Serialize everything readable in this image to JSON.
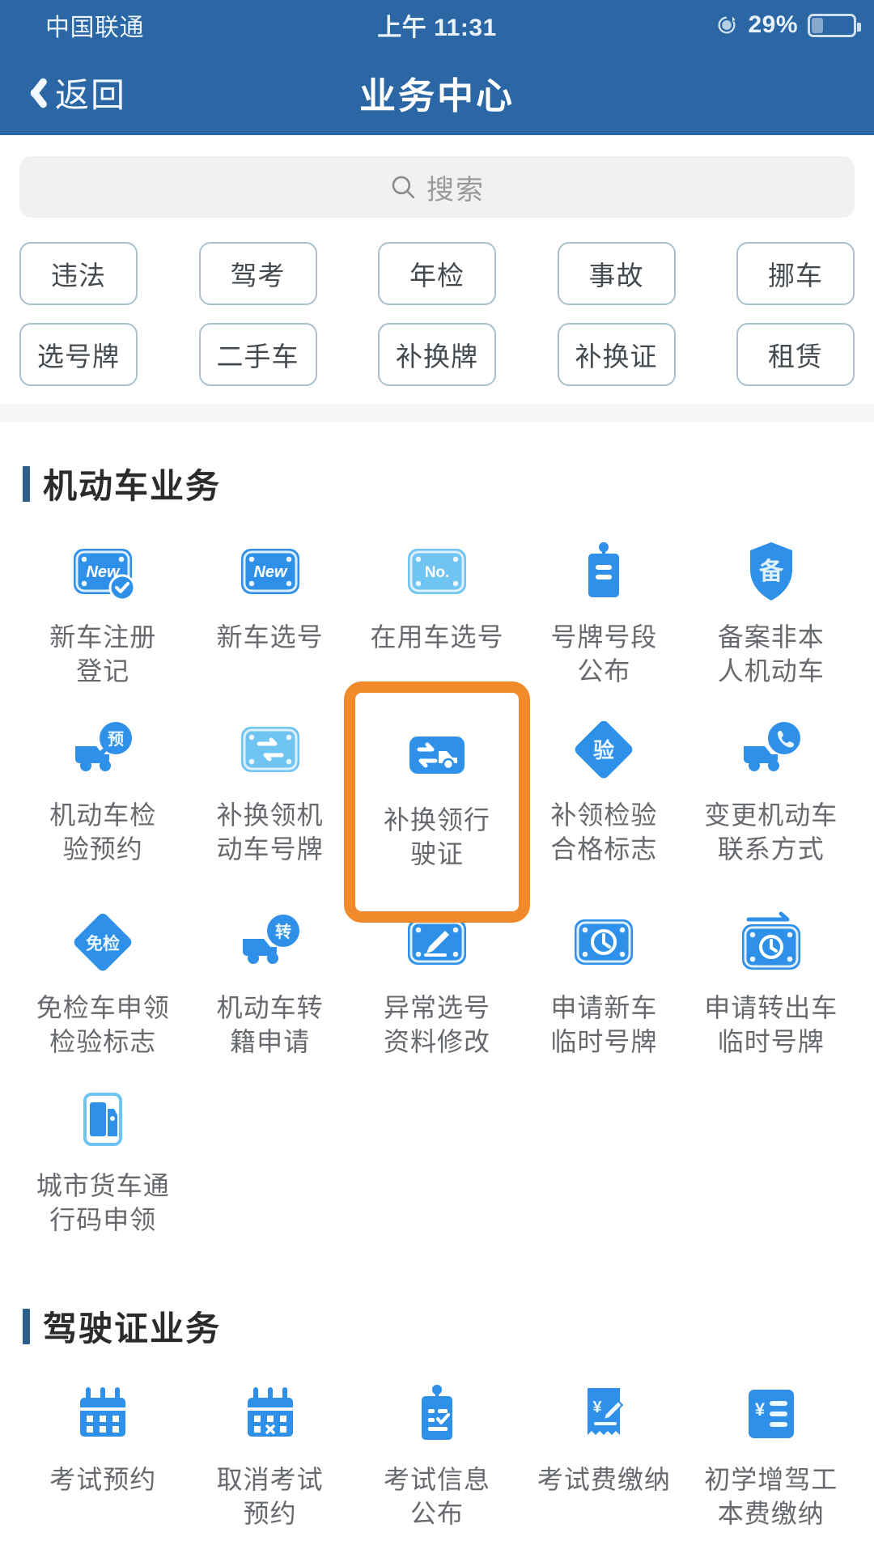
{
  "status_bar": {
    "carrier": "中国联通",
    "time": "上午 11:31",
    "battery_percent": "29%",
    "rotation_icon": "rotation-lock-icon",
    "battery_icon": "battery-icon"
  },
  "nav": {
    "back_label": "返回",
    "back_icon": "chevron-left-icon",
    "title": "业务中心"
  },
  "search": {
    "placeholder": "搜索",
    "icon": "search-icon",
    "value": ""
  },
  "quick_tags": {
    "row1": [
      "违法",
      "驾考",
      "年检",
      "事故",
      "挪车"
    ],
    "row2": [
      "选号牌",
      "二手车",
      "补换牌",
      "补换证",
      "租赁"
    ]
  },
  "colors": {
    "header_blue": "#2B66A5",
    "accent_bar": "#2d5f8a",
    "highlight_orange": "#F08A2A",
    "icon_blue": "#2E90E8",
    "icon_blue_light": "#6FC4F2",
    "label_gray": "#666a6e",
    "tag_border": "#a9c1cd",
    "search_bg": "#f1f1f1"
  },
  "sections": [
    {
      "title": "机动车业务",
      "items": [
        {
          "label": "新车注册\n登记",
          "icon": "new-plate-check-icon",
          "highlighted": false
        },
        {
          "label": "新车选号",
          "icon": "new-plate-icon",
          "highlighted": false
        },
        {
          "label": "在用车选号",
          "icon": "plate-number-icon",
          "highlighted": false
        },
        {
          "label": "号牌号段\n公布",
          "icon": "plate-tag-icon",
          "highlighted": false
        },
        {
          "label": "备案非本\n人机动车",
          "icon": "shield-record-icon",
          "highlighted": false
        },
        {
          "label": "机动车检\n验预约",
          "icon": "truck-booking-icon",
          "highlighted": false
        },
        {
          "label": "补换领机\n动车号牌",
          "icon": "plate-exchange-icon",
          "highlighted": false
        },
        {
          "label": "补换领行\n驶证",
          "icon": "vehicle-license-exchange-icon",
          "highlighted": true
        },
        {
          "label": "补领检验\n合格标志",
          "icon": "inspection-diamond-icon",
          "highlighted": false
        },
        {
          "label": "变更机动车\n联系方式",
          "icon": "truck-phone-icon",
          "highlighted": false
        },
        {
          "label": "免检车申领\n检验标志",
          "icon": "exempt-diamond-icon",
          "highlighted": false
        },
        {
          "label": "机动车转\n籍申请",
          "icon": "truck-transfer-icon",
          "highlighted": false
        },
        {
          "label": "异常选号\n资料修改",
          "icon": "plate-edit-icon",
          "highlighted": false
        },
        {
          "label": "申请新车\n临时号牌",
          "icon": "plate-clock-icon",
          "highlighted": false
        },
        {
          "label": "申请转出车\n临时号牌",
          "icon": "plate-clock-arrow-icon",
          "highlighted": false
        },
        {
          "label": "城市货车通\n行码申领",
          "icon": "city-truck-icon",
          "highlighted": false
        }
      ]
    },
    {
      "title": "驾驶证业务",
      "items": [
        {
          "label": "考试预约",
          "icon": "calendar-icon",
          "highlighted": false
        },
        {
          "label": "取消考试\n预约",
          "icon": "calendar-cancel-icon",
          "highlighted": false
        },
        {
          "label": "考试信息\n公布",
          "icon": "tag-check-icon",
          "highlighted": false
        },
        {
          "label": "考试费缴纳",
          "icon": "receipt-pen-icon",
          "highlighted": false
        },
        {
          "label": "初学增驾工\n本费缴纳",
          "icon": "fee-list-icon",
          "highlighted": false
        }
      ]
    }
  ]
}
